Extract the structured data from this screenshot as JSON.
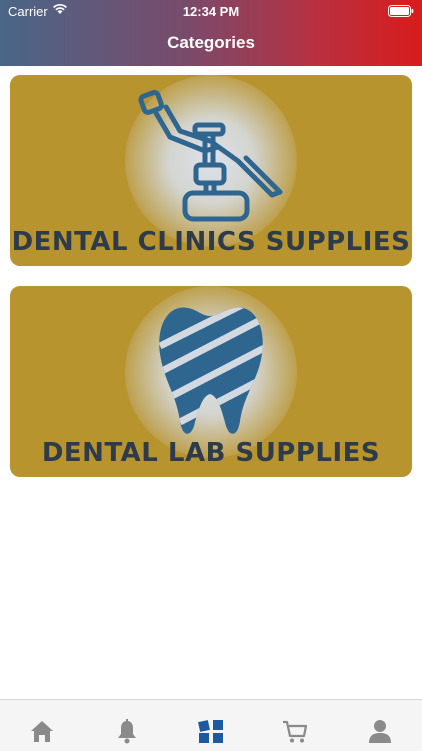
{
  "status_bar": {
    "carrier": "Carrier",
    "time": "12:34 PM"
  },
  "header": {
    "title": "Categories"
  },
  "categories": [
    {
      "label": "DENTAL CLINICS SUPPLIES",
      "icon": "dental-chair-icon"
    },
    {
      "label": "DENTAL LAB SUPPLIES",
      "icon": "tooth-icon"
    }
  ],
  "tab_bar": {
    "items": [
      {
        "icon": "home-icon",
        "active": false
      },
      {
        "icon": "bell-icon",
        "active": false
      },
      {
        "icon": "categories-grid-icon",
        "active": true
      },
      {
        "icon": "cart-icon",
        "active": false
      },
      {
        "icon": "profile-icon",
        "active": false
      }
    ]
  },
  "colors": {
    "header_gradient_start": "#4a6688",
    "header_gradient_end": "#d81c1c",
    "card_background": "#b8942f",
    "icon_blue": "#2f6690",
    "label_text": "#2e3b4a",
    "active_tab": "#1e5aa0",
    "inactive_tab": "#8a8a8a"
  }
}
